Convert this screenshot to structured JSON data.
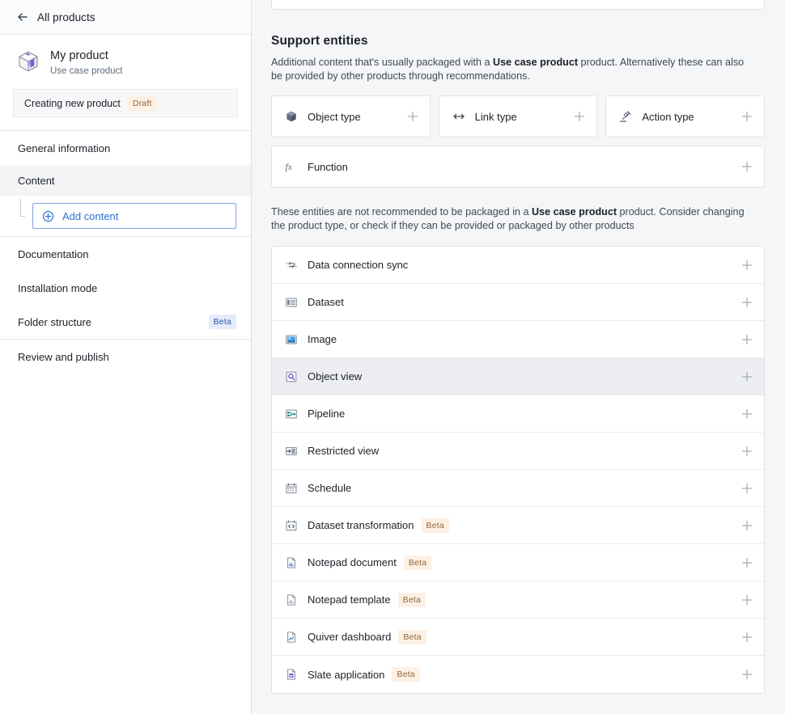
{
  "sidebar": {
    "back_label": "All products",
    "back_icon": "arrow-left-icon",
    "product": {
      "icon": "product-box-icon",
      "name": "My product",
      "type": "Use case product"
    },
    "status": {
      "label": "Creating new product",
      "badge": "Draft"
    },
    "nav": [
      {
        "label": "General information",
        "kind": "plain",
        "badge": ""
      },
      {
        "label": "Content",
        "kind": "section",
        "badge": ""
      },
      {
        "label": "Documentation",
        "kind": "plain",
        "badge": ""
      },
      {
        "label": "Installation mode",
        "kind": "plain",
        "badge": ""
      },
      {
        "label": "Folder structure",
        "kind": "plain",
        "badge": "Beta"
      },
      {
        "label": "Review and publish",
        "kind": "plain",
        "badge": ""
      }
    ],
    "add_content": {
      "label": "Add content",
      "icon": "plus-circle-icon"
    }
  },
  "main": {
    "section_title": "Support entities",
    "section_desc_a": "Additional content that's usually packaged with a ",
    "section_desc_strong": "Use case product",
    "section_desc_b": " product. Alternatively these can also be provided by other products through recommendations.",
    "recommended_cards": [
      {
        "label": "Object type",
        "icon": "cube-icon"
      },
      {
        "label": "Link type",
        "icon": "double-arrow-icon"
      },
      {
        "label": "Action type",
        "icon": "gavel-icon"
      }
    ],
    "function_card": {
      "label": "Function",
      "icon": "fx-icon"
    },
    "note_desc_a": "These entities are not recommended to be packaged in a ",
    "note_desc_strong": "Use case product",
    "note_desc_b": " product. Consider changing the product type, or check if they can be provided or packaged by other products",
    "add_icon": "plus-icon",
    "entities": [
      {
        "label": "Data connection sync",
        "icon": "data-connection-sync-icon",
        "badge": "",
        "hovered": false
      },
      {
        "label": "Dataset",
        "icon": "dataset-icon",
        "badge": "",
        "hovered": false
      },
      {
        "label": "Image",
        "icon": "image-icon",
        "badge": "",
        "hovered": false
      },
      {
        "label": "Object view",
        "icon": "object-view-icon",
        "badge": "",
        "hovered": true
      },
      {
        "label": "Pipeline",
        "icon": "pipeline-icon",
        "badge": "",
        "hovered": false
      },
      {
        "label": "Restricted view",
        "icon": "restricted-view-icon",
        "badge": "",
        "hovered": false
      },
      {
        "label": "Schedule",
        "icon": "schedule-icon",
        "badge": "",
        "hovered": false
      },
      {
        "label": "Dataset transformation",
        "icon": "dataset-transformation-icon",
        "badge": "Beta",
        "hovered": false
      },
      {
        "label": "Notepad document",
        "icon": "notepad-document-icon",
        "badge": "Beta",
        "hovered": false
      },
      {
        "label": "Notepad template",
        "icon": "notepad-template-icon",
        "badge": "Beta",
        "hovered": false
      },
      {
        "label": "Quiver dashboard",
        "icon": "quiver-dashboard-icon",
        "badge": "Beta",
        "hovered": false
      },
      {
        "label": "Slate application",
        "icon": "slate-application-icon",
        "badge": "Beta",
        "hovered": false
      }
    ]
  },
  "colors": {
    "accent_blue": "#2d72d2",
    "badge_orange_bg": "#fdf0e4",
    "badge_orange_fg": "#946638",
    "badge_blue_bg": "#e4ecfb",
    "badge_blue_fg": "#315ca0",
    "page_bg": "#f5f6f8",
    "card_bg": "#ffffff",
    "hover_bg": "#eceef1",
    "purple": "#7c5cd6"
  }
}
